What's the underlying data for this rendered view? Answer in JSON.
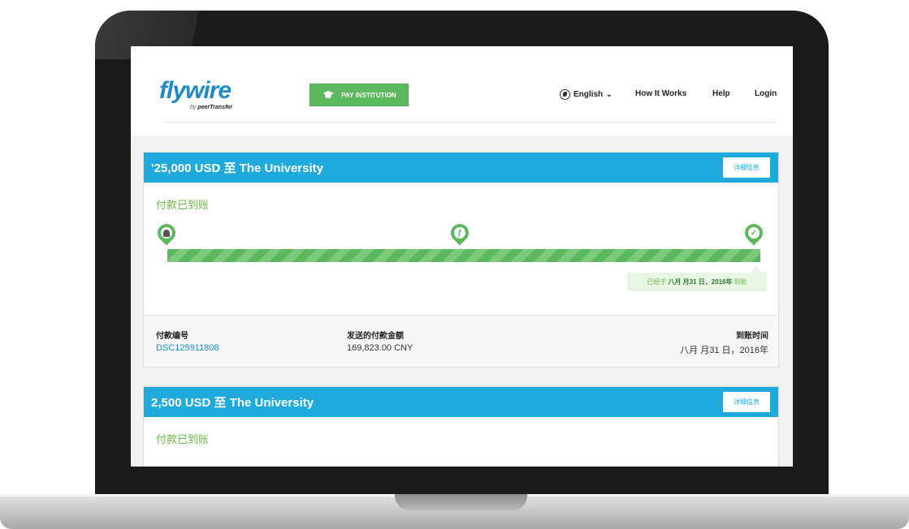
{
  "header": {
    "logo_text": "flywire",
    "logo_sub_by": "by",
    "logo_sub_brand": "peerTransfer",
    "pay_button": "PAY INSTITUTION",
    "language": "English",
    "nav": [
      "How It Works",
      "Help",
      "Login"
    ]
  },
  "payments": [
    {
      "title": "'25,000 USD 至 The University",
      "detail_button": "详细信息",
      "status": "付款已到账",
      "arrival_prefix": "已经于",
      "arrival_bold": "八月 月31 日，2016年",
      "arrival_suffix": "到账",
      "labels": {
        "id": "付款编号",
        "amount": "发送的付款金额",
        "time": "到账时间"
      },
      "values": {
        "id": "DSC125911808",
        "amount": "169,823.00 CNY",
        "time": "八月 月31 日，2016年"
      },
      "progress_percent": 100
    },
    {
      "title": "2,500 USD 至 The University",
      "detail_button": "详细信息",
      "status": "付款已到账"
    }
  ],
  "colors": {
    "brand_blue": "#1faadb",
    "success_green": "#5cb85c"
  }
}
